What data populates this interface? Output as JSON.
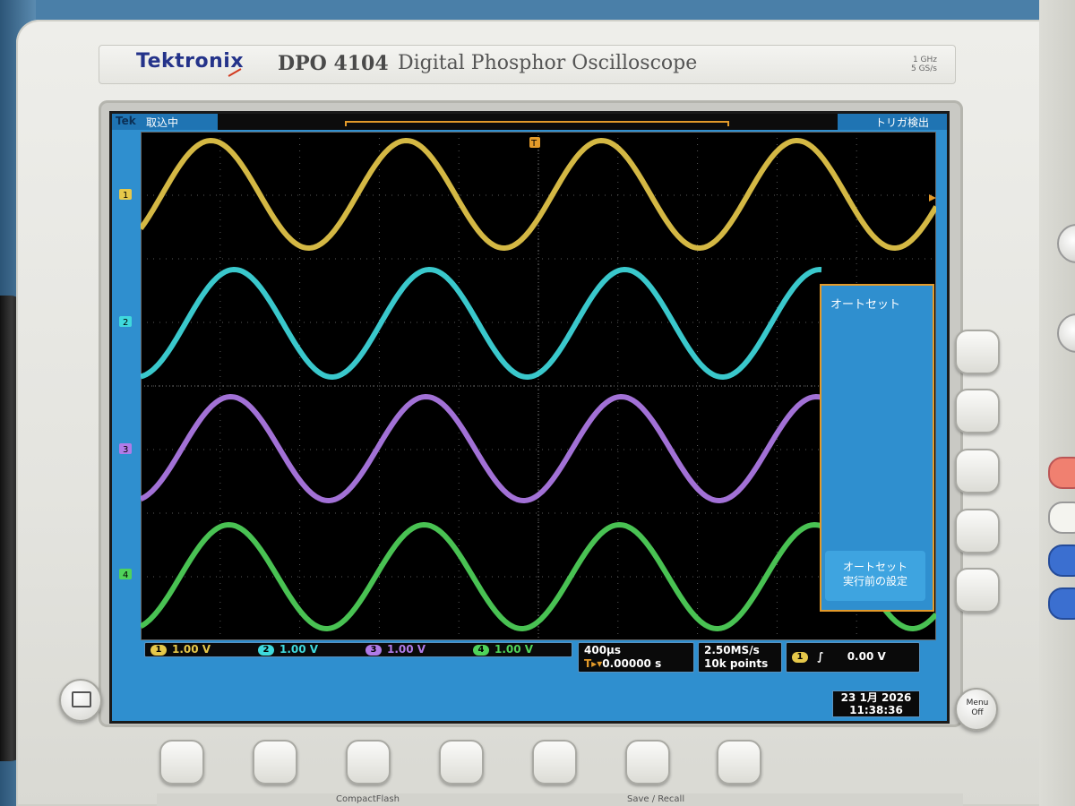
{
  "instrument": {
    "brand": "Tektronix",
    "model": "DPO 4104",
    "description": "Digital Phosphor Oscilloscope",
    "spec_line1": "1 GHz",
    "spec_line2": "5 GS/s"
  },
  "screen": {
    "tek_label": "Tek",
    "acquisition_status": "取込中",
    "trigger_status": "トリガ検出",
    "trigger_marker": "T"
  },
  "channels": [
    {
      "id": "1",
      "scale": "1.00 V",
      "color": "#e6c84a"
    },
    {
      "id": "2",
      "scale": "1.00 V",
      "color": "#3fd9dd"
    },
    {
      "id": "3",
      "scale": "1.00 V",
      "color": "#b07be8"
    },
    {
      "id": "4",
      "scale": "1.00 V",
      "color": "#4fd35a"
    }
  ],
  "timebase": {
    "scale": "400μs",
    "position": "0.00000 s"
  },
  "acquisition": {
    "sample_rate": "2.50MS/s",
    "record_length": "10k points"
  },
  "trigger": {
    "source": "1",
    "level": "0.00 V"
  },
  "datetime": {
    "date": "23 1月 2026",
    "time": "11:38:36"
  },
  "side_menu": {
    "title": "オートセット",
    "undo_line1": "オートセット",
    "undo_line2": "実行前の設定"
  },
  "buttons": {
    "menu_off_line1": "Menu",
    "menu_off_line2": "Off"
  },
  "bottom_labels": {
    "compact_flash": "CompactFlash",
    "save_recall": "Save / Recall"
  }
}
